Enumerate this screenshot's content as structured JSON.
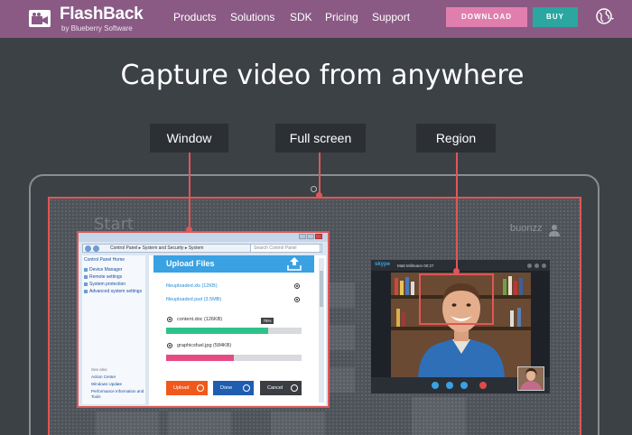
{
  "nav": {
    "brand": "FlashBack",
    "brand_sub": "by Blueberry Software",
    "links": [
      "Products",
      "Solutions",
      "SDK",
      "Pricing",
      "Support"
    ],
    "download_label": "DOWNLOAD",
    "buy_label": "BUY"
  },
  "hero": {
    "headline": "Capture video from anywhere",
    "modes": [
      "Window",
      "Full screen",
      "Region"
    ]
  },
  "desktop": {
    "start_label": "Start",
    "user_name": "buonzz"
  },
  "explorer": {
    "address": "Control Panel  ▸  System and Security  ▸  System",
    "search_placeholder": "Search Control Panel",
    "side_home": "Control Panel Home",
    "side_items": [
      "Device Manager",
      "Remote settings",
      "System protection",
      "Advanced system settings"
    ],
    "see_also": "See also",
    "see_also_items": [
      "Action Center",
      "Windows Update",
      "Performance Information and Tools"
    ]
  },
  "upload": {
    "title": "Upload Files",
    "uploaded": [
      "fileuploaded.xls (12KB)",
      "fileuploaded.psd (3.5MB)"
    ],
    "pending": [
      {
        "name": "content.doc (126KB)",
        "progress": 0.75,
        "color": "#2ec28a"
      },
      {
        "name": "graphicsfuel.jpg (584KB)",
        "progress": 0.5,
        "color": "#e64b83"
      }
    ],
    "progress_tag": "75%",
    "buttons": [
      {
        "label": "Upload",
        "color": "#ef5a1c"
      },
      {
        "label": "Done",
        "color": "#1f5db0"
      },
      {
        "label": "Cancel",
        "color": "#3a3d42"
      }
    ]
  },
  "skype": {
    "logo": "skype",
    "caller": "Matt Millmann  00:27"
  }
}
